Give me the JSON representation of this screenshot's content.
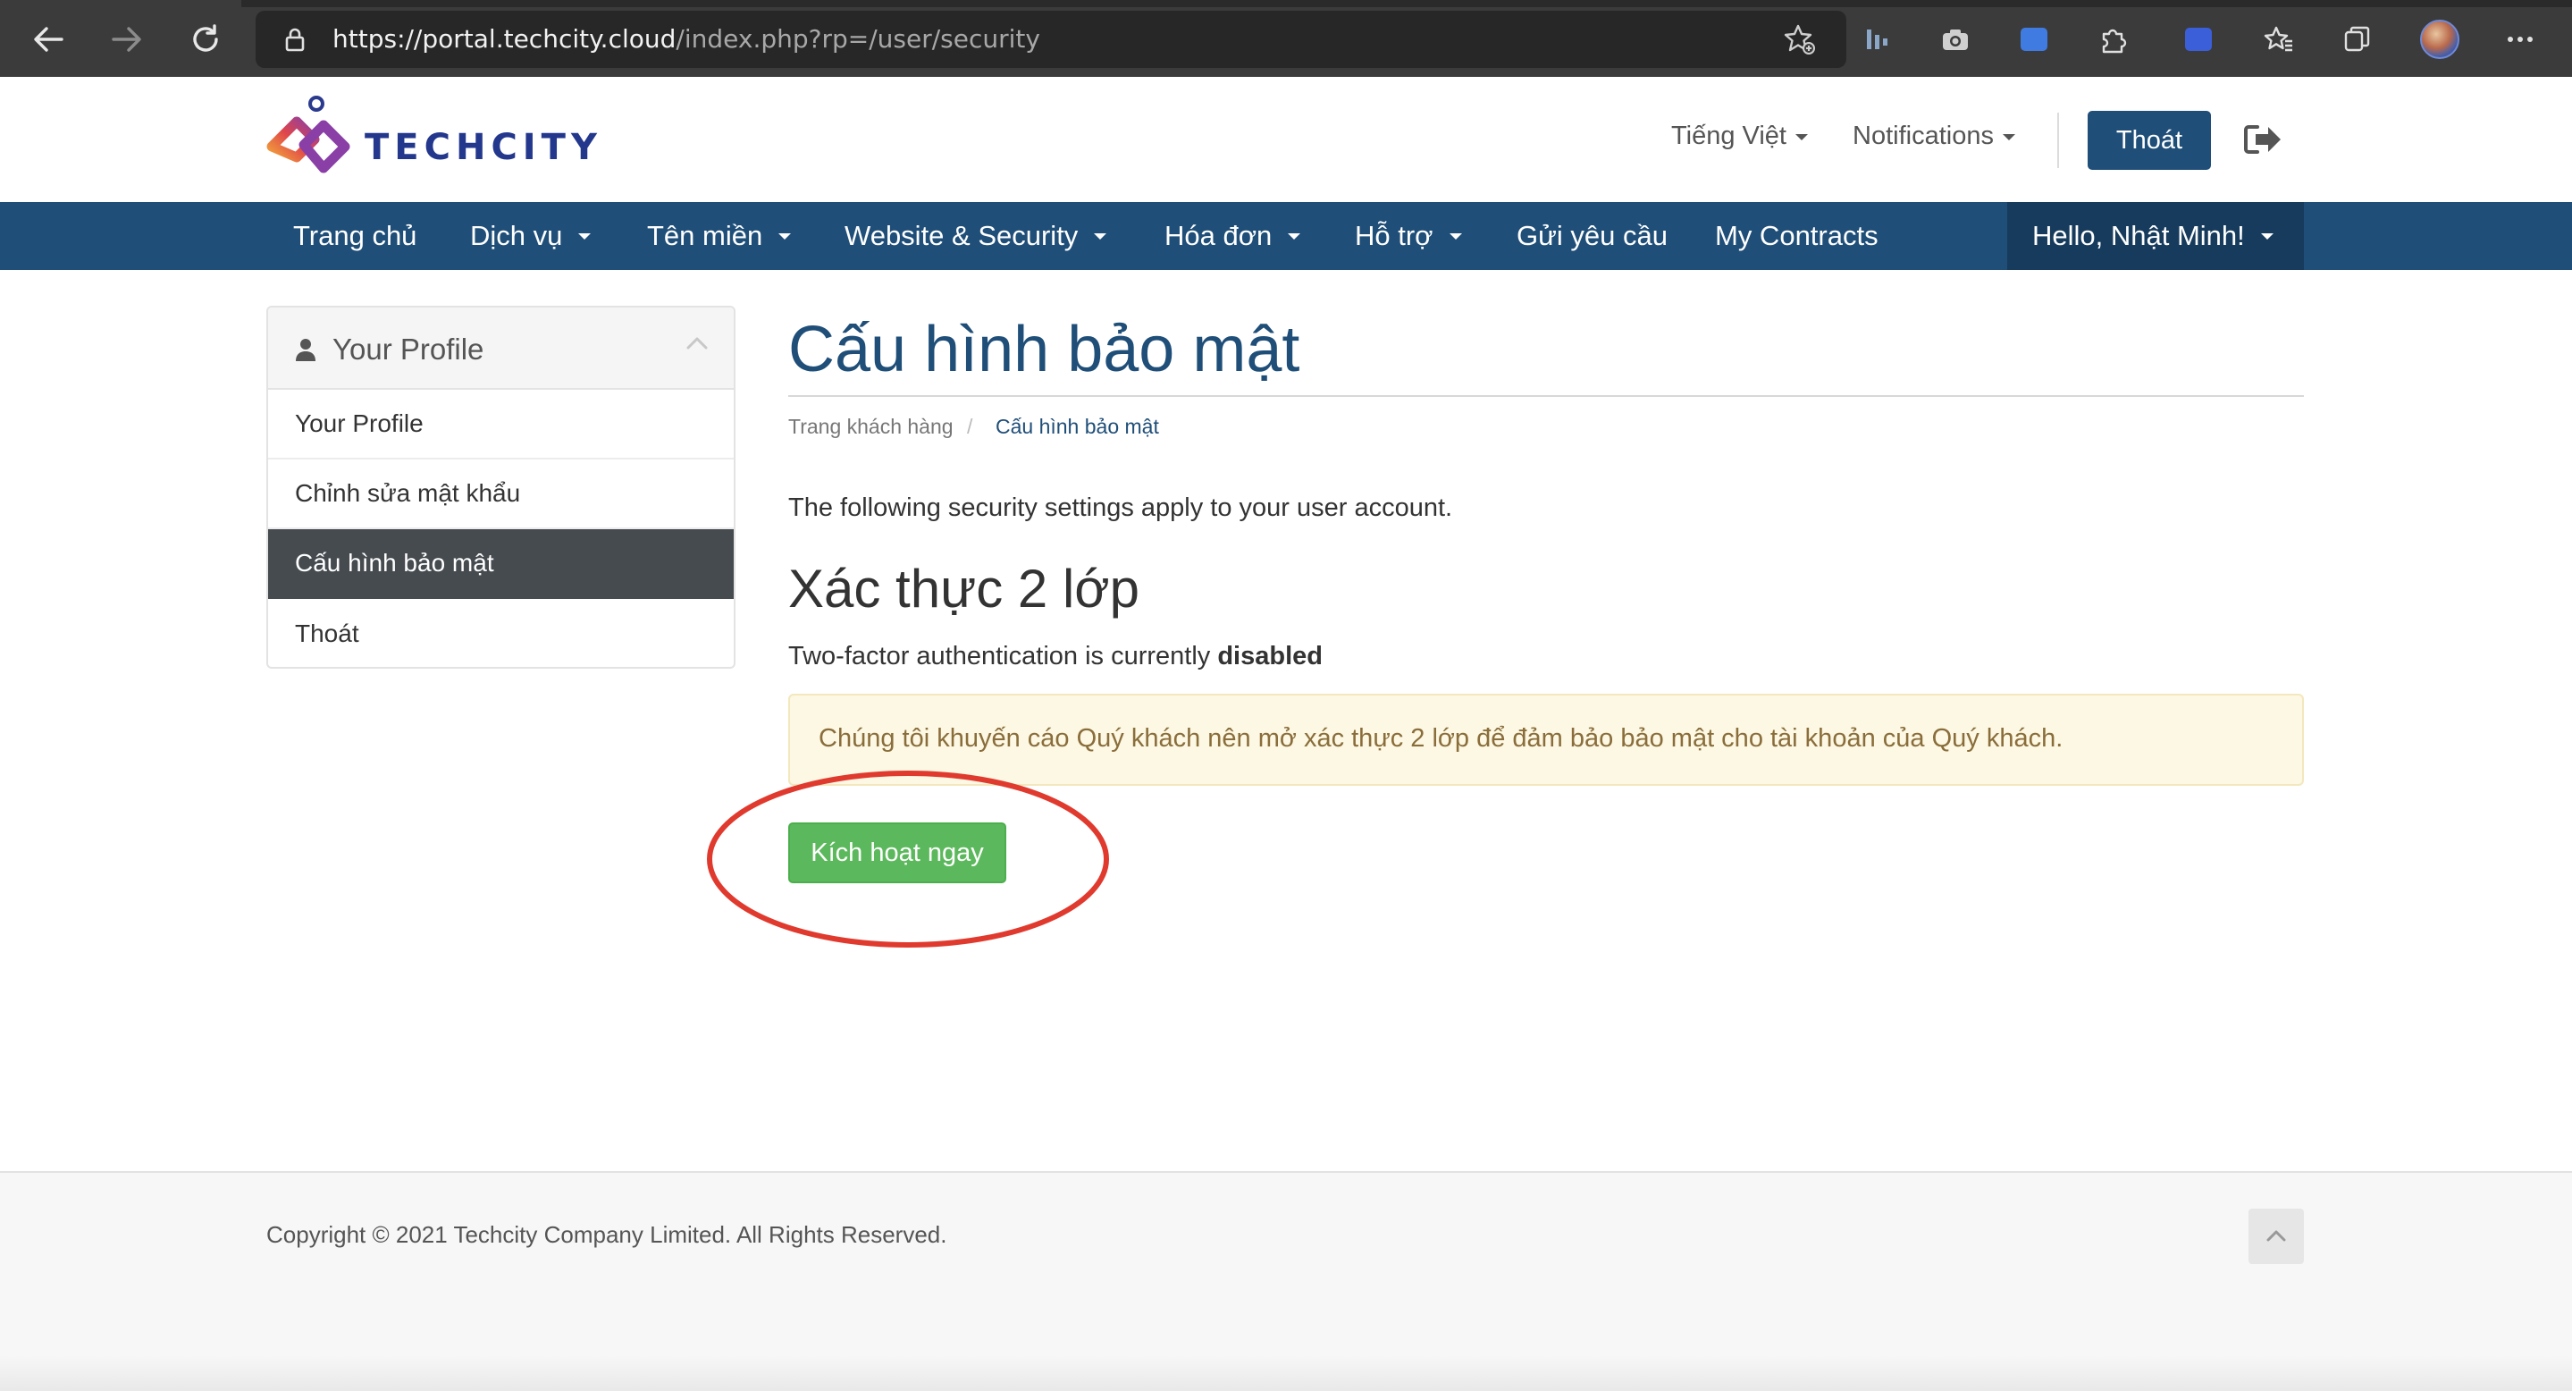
{
  "browser": {
    "url_main": "https://portal.techcity.cloud",
    "url_path": "/index.php?rp=/user/security"
  },
  "header": {
    "logo_text": "TECHCITY",
    "language": "Tiếng Việt",
    "notifications": "Notifications",
    "logout_button": "Thoát"
  },
  "navbar": {
    "items": [
      "Trang chủ",
      "Dịch vụ",
      "Tên miền",
      "Website & Security",
      "Hóa đơn",
      "Hỗ trợ",
      "Gửi yêu cầu",
      "My Contracts"
    ],
    "user_menu": "Hello, Nhật Minh!"
  },
  "sidebar": {
    "title": "Your Profile",
    "items": [
      "Your Profile",
      "Chỉnh sửa mật khẩu",
      "Cấu hình bảo mật",
      "Thoát"
    ],
    "active_index": 2
  },
  "main": {
    "title": "Cấu hình bảo mật",
    "breadcrumb": {
      "home": "Trang khách hàng",
      "separator": "/",
      "current": "Cấu hình bảo mật"
    },
    "intro": "The following security settings apply to your user account.",
    "section_title": "Xác thực 2 lớp",
    "status_prefix": "Two-factor authentication is currently",
    "status_value": "disabled",
    "alert": "Chúng tôi khuyến cáo Quý khách nên mở xác thực 2 lớp để đảm bảo bảo mật cho tài khoản của Quý khách.",
    "enable_button": "Kích hoạt ngay"
  },
  "footer": {
    "copyright": "Copyright © 2021 Techcity Company Limited. All Rights Reserved."
  },
  "colors": {
    "brand_blue": "#1f4e78",
    "success_green": "#5cb85c",
    "annotation_red": "#e03a2f",
    "alert_bg": "#fcf8e3"
  }
}
